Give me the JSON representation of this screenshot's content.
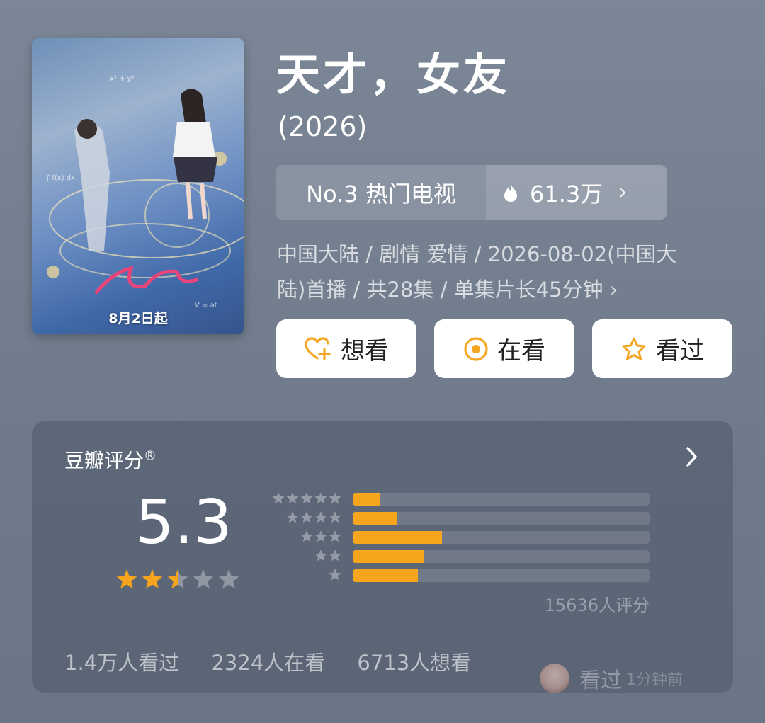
{
  "show": {
    "title": "天才，女友",
    "year": "(2026)",
    "poster_date": "8月2日起"
  },
  "rank": {
    "label": "No.3 热门电视",
    "heat": "61.3万",
    "chevron": "›"
  },
  "meta": {
    "line1": "中国大陆 / 剧情 爱情 / 2026-08-02(中国大",
    "line2": "陆)首播 / 共28集 / 单集片长45分钟 ›"
  },
  "actions": [
    {
      "label": "想看",
      "icon": "heart-plus-icon"
    },
    {
      "label": "在看",
      "icon": "circle-dot-icon"
    },
    {
      "label": "看过",
      "icon": "star-outline-icon"
    }
  ],
  "rating": {
    "title": "豆瓣评分",
    "registered": "®",
    "score": "5.3",
    "star_value": 2.5,
    "count_text": "15636人评分",
    "distribution": [
      {
        "stars": 5,
        "fraction": 0.09
      },
      {
        "stars": 4,
        "fraction": 0.15
      },
      {
        "stars": 3,
        "fraction": 0.3
      },
      {
        "stars": 2,
        "fraction": 0.24
      },
      {
        "stars": 1,
        "fraction": 0.22
      }
    ]
  },
  "stats": {
    "watched": "1.4万人看过",
    "watching": "2324人在看",
    "want": "6713人想看"
  },
  "watermark": {
    "text": "看过",
    "sub": "1分钟前"
  },
  "colors": {
    "accent_orange": "#f7a51c",
    "button_icon": "#f5a623"
  }
}
